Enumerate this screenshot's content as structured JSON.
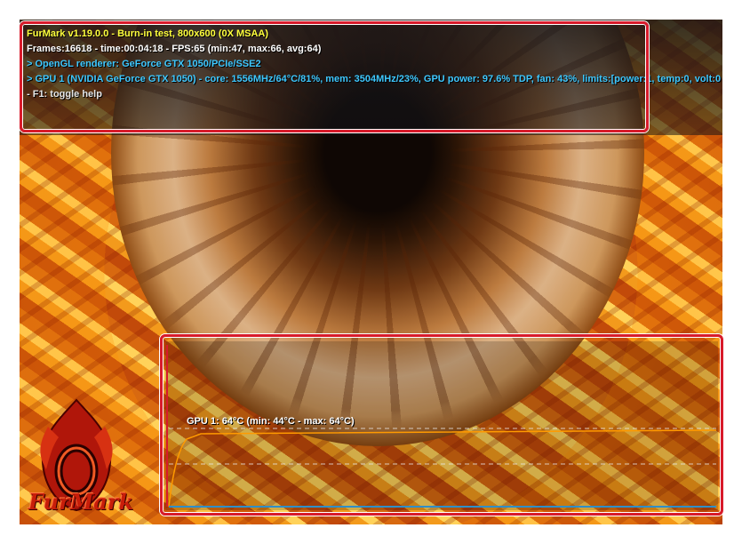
{
  "hud": {
    "title": "FurMark v1.19.0.0 - Burn-in test, 800x600 (0X MSAA)",
    "frames": "Frames:16618 - time:00:04:18 - FPS:65 (min:47, max:66, avg:64)",
    "renderer": "> OpenGL renderer: GeForce GTX 1050/PCIe/SSE2",
    "gpu": "> GPU 1 (NVIDIA GeForce GTX 1050) - core: 1556MHz/64°C/81%, mem: 3504MHz/23%, GPU power: 97.6% TDP, fan: 43%, limits:[power:1, temp:0, volt:0",
    "help": "- F1: toggle help"
  },
  "graph": {
    "label": "GPU 1: 64°C (min: 44°C - max: 64°C)"
  },
  "logo": {
    "text": "FurMark"
  },
  "colors": {
    "highlight": "#d81b2b",
    "hud_title": "#ffff3c",
    "hud_info": "#3ec8ff",
    "temp_line": "#ff9a00",
    "baseline": "#2f8fc8"
  }
}
